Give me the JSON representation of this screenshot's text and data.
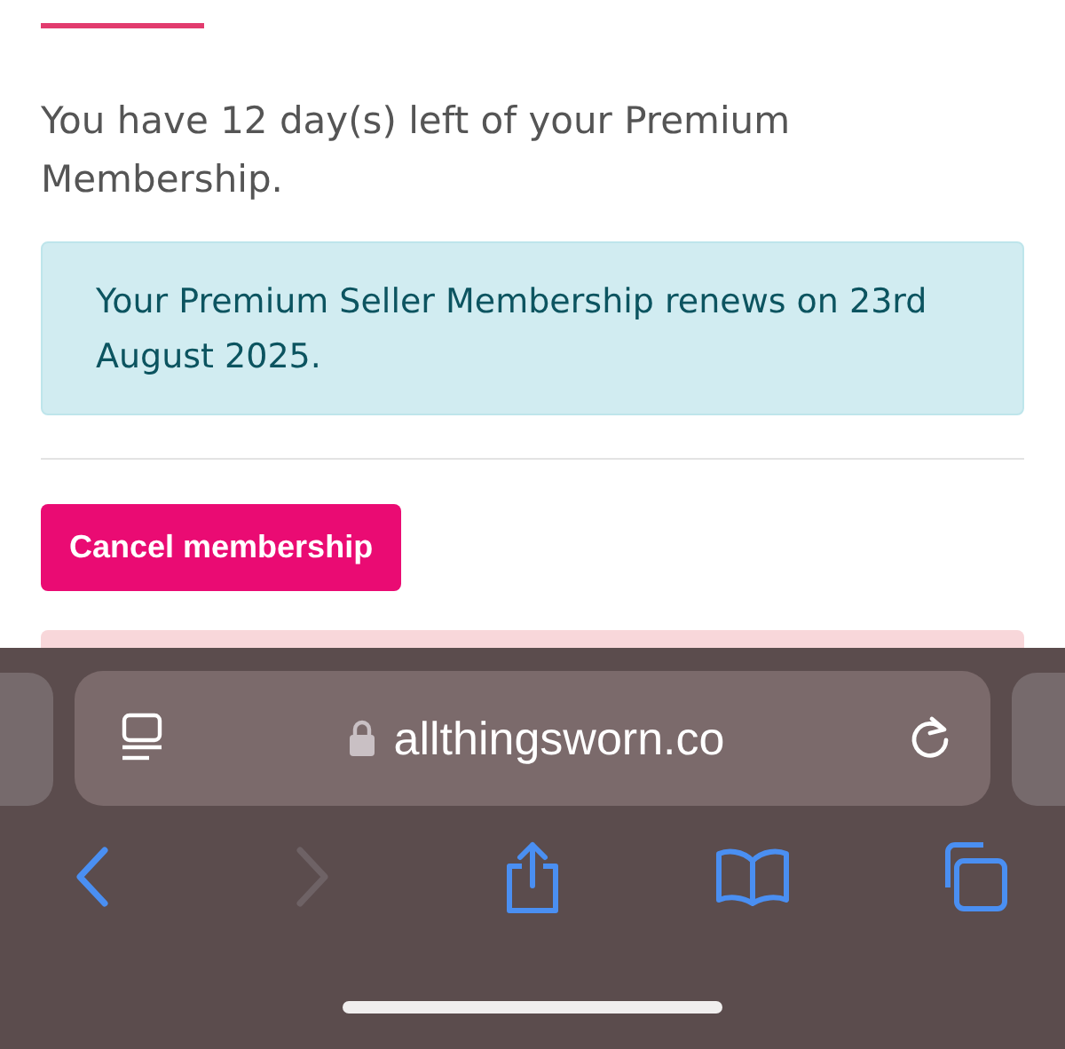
{
  "page": {
    "remaining_text": "You have 12 day(s) left of your Premium Membership.",
    "renewal_notice": "Your Premium Seller Membership renews on 23rd August 2025.",
    "cancel_button": "Cancel membership"
  },
  "browser": {
    "url": "allthingsworn.co",
    "nav": [
      {
        "kind": "back",
        "disabled": false
      },
      {
        "kind": "forward",
        "disabled": true
      },
      {
        "kind": "share",
        "disabled": false
      },
      {
        "kind": "bookmarks",
        "disabled": false
      },
      {
        "kind": "tabs",
        "disabled": false
      }
    ]
  }
}
